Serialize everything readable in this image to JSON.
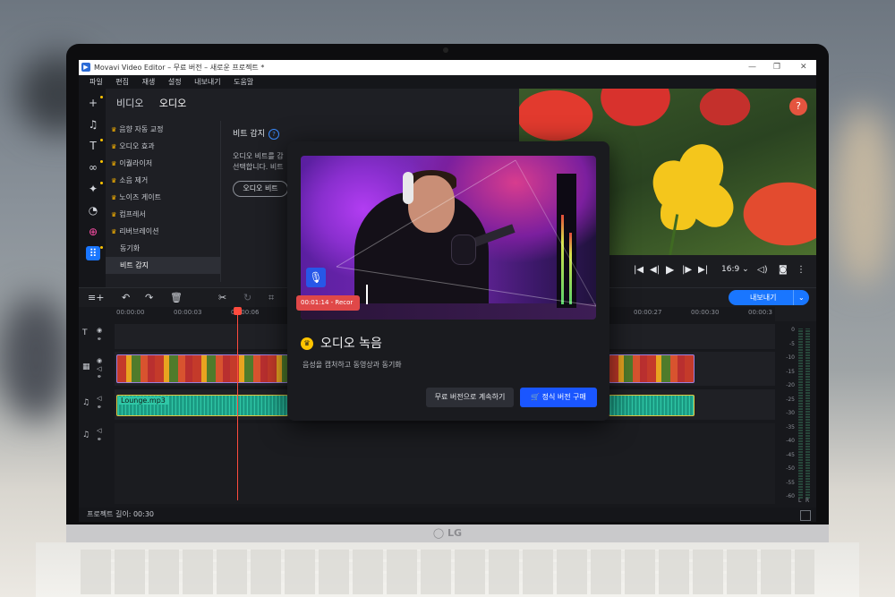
{
  "window": {
    "title": "Movavi Video Editor – 무료 버전 – 새로운 프로젝트 *",
    "minimize": "—",
    "maximize": "❐",
    "close": "✕"
  },
  "menu": [
    "파일",
    "편집",
    "재생",
    "설정",
    "내보내기",
    "도움말"
  ],
  "tools": [
    "plus-icon",
    "music-note-icon",
    "text-icon",
    "transition-icon",
    "magic-icon",
    "clock-icon",
    "sticker-icon",
    "apps-icon"
  ],
  "panel": {
    "tabs": [
      "비디오",
      "오디오"
    ],
    "items": [
      {
        "label": "음향 자동 교정",
        "premium": true
      },
      {
        "label": "오디오 효과",
        "premium": true
      },
      {
        "label": "이퀄라이저",
        "premium": true
      },
      {
        "label": "소음 제거",
        "premium": true
      },
      {
        "label": "노이즈 게이트",
        "premium": true
      },
      {
        "label": "컴프레서",
        "premium": true
      },
      {
        "label": "리버브레이션",
        "premium": true
      },
      {
        "label": "동기화",
        "premium": false
      },
      {
        "label": "비트 감지",
        "premium": false
      }
    ],
    "detail_title": "비트 감지",
    "detail_help": "?",
    "detail_desc_1": "오디오 비트를 감",
    "detail_desc_2": "선택합니다. 비트",
    "detail_button": "오디오 비트"
  },
  "preview": {
    "help": "?",
    "aspect": "16:9 ⌄"
  },
  "timeline": {
    "export_label": "내보내기",
    "ruler": [
      "00:00:00",
      "00:00:03",
      "00:00:06",
      "00:00:27",
      "00:00:30",
      "00:00:3"
    ],
    "audio_clip_label": "Lounge.mp3",
    "meter_ticks": [
      "0",
      "-5",
      "-10",
      "-15",
      "-20",
      "-25",
      "-30",
      "-35",
      "-40",
      "-45",
      "-50",
      "-55",
      "-60"
    ],
    "meter_lr": [
      "L",
      "R"
    ]
  },
  "status": {
    "project_length": "프로젝트 길이: 00:30"
  },
  "modal": {
    "rec_time": "00:01:14 - Recor",
    "title": "오디오 녹음",
    "description": "음성을 캡처하고 동영상과 동기화",
    "free_button": "무료 버전으로 계속하기",
    "buy_button": "정식 버전 구매"
  }
}
